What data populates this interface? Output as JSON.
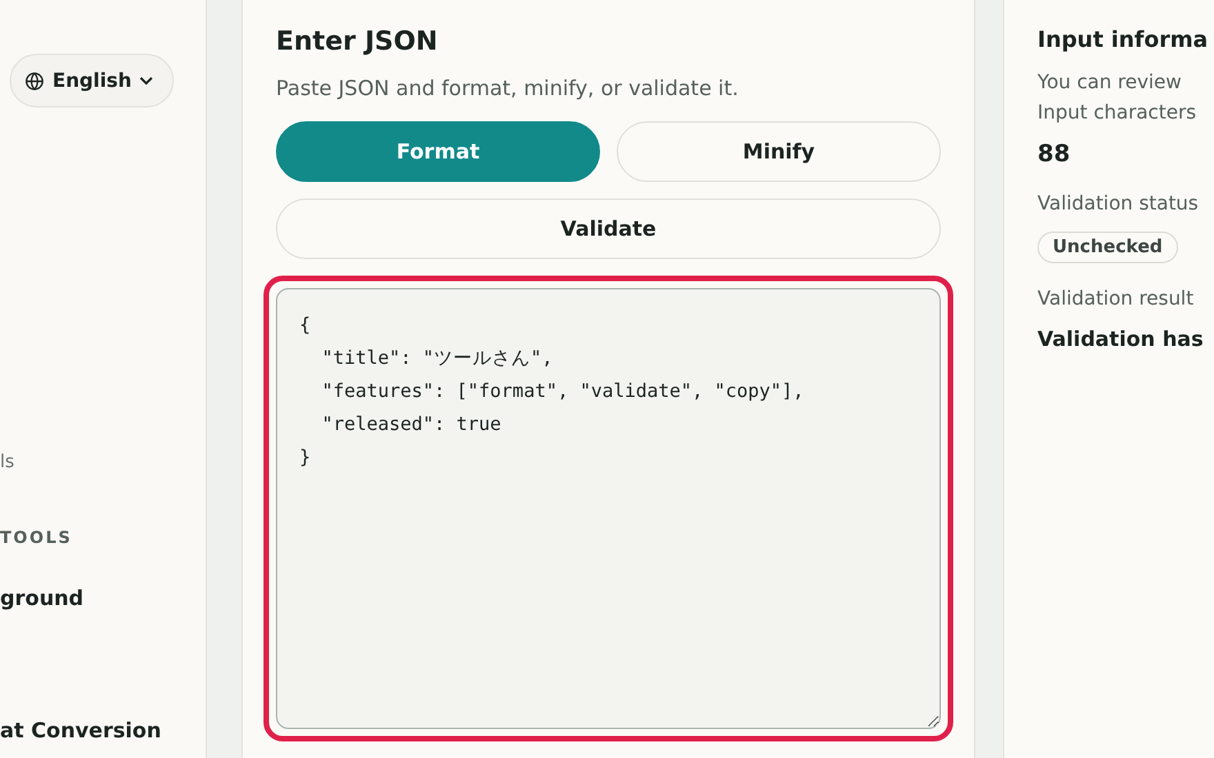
{
  "sidebar": {
    "language": {
      "label": "English"
    },
    "items": [
      {
        "kind": "link",
        "label": "ls"
      },
      {
        "kind": "heading",
        "label": "TOOLS"
      },
      {
        "kind": "link",
        "label": "ground"
      },
      {
        "kind": "link",
        "label": "at Conversion"
      }
    ]
  },
  "editor": {
    "title": "Enter JSON",
    "description": "Paste JSON and format, minify, or validate it.",
    "buttons": [
      {
        "label": "Format",
        "selected": true
      },
      {
        "label": "Minify",
        "selected": false
      },
      {
        "label": "Validate",
        "selected": false
      }
    ],
    "input": {
      "value": "{\n  \"title\": \"ツールさん\",\n  \"features\": [\"format\", \"validate\", \"copy\"],\n  \"released\": true\n}",
      "focused": true
    }
  },
  "info": {
    "title": "Input informa",
    "description": "You can review",
    "fields": [
      {
        "kind": "value",
        "label": "Input characters",
        "value": "88"
      },
      {
        "kind": "badge",
        "label": "Validation status",
        "value": "Unchecked"
      },
      {
        "kind": "text",
        "label": "Validation result",
        "value": "Validation has"
      }
    ]
  }
}
